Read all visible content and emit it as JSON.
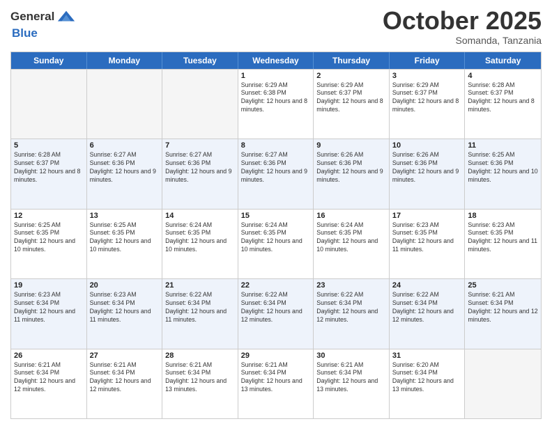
{
  "header": {
    "logo_general": "General",
    "logo_blue": "Blue",
    "month": "October 2025",
    "location": "Somanda, Tanzania"
  },
  "days_of_week": [
    "Sunday",
    "Monday",
    "Tuesday",
    "Wednesday",
    "Thursday",
    "Friday",
    "Saturday"
  ],
  "rows": [
    [
      {
        "day": "",
        "sunrise": "",
        "sunset": "",
        "daylight": "",
        "empty": true
      },
      {
        "day": "",
        "sunrise": "",
        "sunset": "",
        "daylight": "",
        "empty": true
      },
      {
        "day": "",
        "sunrise": "",
        "sunset": "",
        "daylight": "",
        "empty": true
      },
      {
        "day": "1",
        "sunrise": "Sunrise: 6:29 AM",
        "sunset": "Sunset: 6:38 PM",
        "daylight": "Daylight: 12 hours and 8 minutes.",
        "empty": false
      },
      {
        "day": "2",
        "sunrise": "Sunrise: 6:29 AM",
        "sunset": "Sunset: 6:37 PM",
        "daylight": "Daylight: 12 hours and 8 minutes.",
        "empty": false
      },
      {
        "day": "3",
        "sunrise": "Sunrise: 6:29 AM",
        "sunset": "Sunset: 6:37 PM",
        "daylight": "Daylight: 12 hours and 8 minutes.",
        "empty": false
      },
      {
        "day": "4",
        "sunrise": "Sunrise: 6:28 AM",
        "sunset": "Sunset: 6:37 PM",
        "daylight": "Daylight: 12 hours and 8 minutes.",
        "empty": false
      }
    ],
    [
      {
        "day": "5",
        "sunrise": "Sunrise: 6:28 AM",
        "sunset": "Sunset: 6:37 PM",
        "daylight": "Daylight: 12 hours and 8 minutes.",
        "empty": false
      },
      {
        "day": "6",
        "sunrise": "Sunrise: 6:27 AM",
        "sunset": "Sunset: 6:36 PM",
        "daylight": "Daylight: 12 hours and 9 minutes.",
        "empty": false
      },
      {
        "day": "7",
        "sunrise": "Sunrise: 6:27 AM",
        "sunset": "Sunset: 6:36 PM",
        "daylight": "Daylight: 12 hours and 9 minutes.",
        "empty": false
      },
      {
        "day": "8",
        "sunrise": "Sunrise: 6:27 AM",
        "sunset": "Sunset: 6:36 PM",
        "daylight": "Daylight: 12 hours and 9 minutes.",
        "empty": false
      },
      {
        "day": "9",
        "sunrise": "Sunrise: 6:26 AM",
        "sunset": "Sunset: 6:36 PM",
        "daylight": "Daylight: 12 hours and 9 minutes.",
        "empty": false
      },
      {
        "day": "10",
        "sunrise": "Sunrise: 6:26 AM",
        "sunset": "Sunset: 6:36 PM",
        "daylight": "Daylight: 12 hours and 9 minutes.",
        "empty": false
      },
      {
        "day": "11",
        "sunrise": "Sunrise: 6:25 AM",
        "sunset": "Sunset: 6:36 PM",
        "daylight": "Daylight: 12 hours and 10 minutes.",
        "empty": false
      }
    ],
    [
      {
        "day": "12",
        "sunrise": "Sunrise: 6:25 AM",
        "sunset": "Sunset: 6:35 PM",
        "daylight": "Daylight: 12 hours and 10 minutes.",
        "empty": false
      },
      {
        "day": "13",
        "sunrise": "Sunrise: 6:25 AM",
        "sunset": "Sunset: 6:35 PM",
        "daylight": "Daylight: 12 hours and 10 minutes.",
        "empty": false
      },
      {
        "day": "14",
        "sunrise": "Sunrise: 6:24 AM",
        "sunset": "Sunset: 6:35 PM",
        "daylight": "Daylight: 12 hours and 10 minutes.",
        "empty": false
      },
      {
        "day": "15",
        "sunrise": "Sunrise: 6:24 AM",
        "sunset": "Sunset: 6:35 PM",
        "daylight": "Daylight: 12 hours and 10 minutes.",
        "empty": false
      },
      {
        "day": "16",
        "sunrise": "Sunrise: 6:24 AM",
        "sunset": "Sunset: 6:35 PM",
        "daylight": "Daylight: 12 hours and 10 minutes.",
        "empty": false
      },
      {
        "day": "17",
        "sunrise": "Sunrise: 6:23 AM",
        "sunset": "Sunset: 6:35 PM",
        "daylight": "Daylight: 12 hours and 11 minutes.",
        "empty": false
      },
      {
        "day": "18",
        "sunrise": "Sunrise: 6:23 AM",
        "sunset": "Sunset: 6:35 PM",
        "daylight": "Daylight: 12 hours and 11 minutes.",
        "empty": false
      }
    ],
    [
      {
        "day": "19",
        "sunrise": "Sunrise: 6:23 AM",
        "sunset": "Sunset: 6:34 PM",
        "daylight": "Daylight: 12 hours and 11 minutes.",
        "empty": false
      },
      {
        "day": "20",
        "sunrise": "Sunrise: 6:23 AM",
        "sunset": "Sunset: 6:34 PM",
        "daylight": "Daylight: 12 hours and 11 minutes.",
        "empty": false
      },
      {
        "day": "21",
        "sunrise": "Sunrise: 6:22 AM",
        "sunset": "Sunset: 6:34 PM",
        "daylight": "Daylight: 12 hours and 11 minutes.",
        "empty": false
      },
      {
        "day": "22",
        "sunrise": "Sunrise: 6:22 AM",
        "sunset": "Sunset: 6:34 PM",
        "daylight": "Daylight: 12 hours and 12 minutes.",
        "empty": false
      },
      {
        "day": "23",
        "sunrise": "Sunrise: 6:22 AM",
        "sunset": "Sunset: 6:34 PM",
        "daylight": "Daylight: 12 hours and 12 minutes.",
        "empty": false
      },
      {
        "day": "24",
        "sunrise": "Sunrise: 6:22 AM",
        "sunset": "Sunset: 6:34 PM",
        "daylight": "Daylight: 12 hours and 12 minutes.",
        "empty": false
      },
      {
        "day": "25",
        "sunrise": "Sunrise: 6:21 AM",
        "sunset": "Sunset: 6:34 PM",
        "daylight": "Daylight: 12 hours and 12 minutes.",
        "empty": false
      }
    ],
    [
      {
        "day": "26",
        "sunrise": "Sunrise: 6:21 AM",
        "sunset": "Sunset: 6:34 PM",
        "daylight": "Daylight: 12 hours and 12 minutes.",
        "empty": false
      },
      {
        "day": "27",
        "sunrise": "Sunrise: 6:21 AM",
        "sunset": "Sunset: 6:34 PM",
        "daylight": "Daylight: 12 hours and 12 minutes.",
        "empty": false
      },
      {
        "day": "28",
        "sunrise": "Sunrise: 6:21 AM",
        "sunset": "Sunset: 6:34 PM",
        "daylight": "Daylight: 12 hours and 13 minutes.",
        "empty": false
      },
      {
        "day": "29",
        "sunrise": "Sunrise: 6:21 AM",
        "sunset": "Sunset: 6:34 PM",
        "daylight": "Daylight: 12 hours and 13 minutes.",
        "empty": false
      },
      {
        "day": "30",
        "sunrise": "Sunrise: 6:21 AM",
        "sunset": "Sunset: 6:34 PM",
        "daylight": "Daylight: 12 hours and 13 minutes.",
        "empty": false
      },
      {
        "day": "31",
        "sunrise": "Sunrise: 6:20 AM",
        "sunset": "Sunset: 6:34 PM",
        "daylight": "Daylight: 12 hours and 13 minutes.",
        "empty": false
      },
      {
        "day": "",
        "sunrise": "",
        "sunset": "",
        "daylight": "",
        "empty": true
      }
    ]
  ]
}
